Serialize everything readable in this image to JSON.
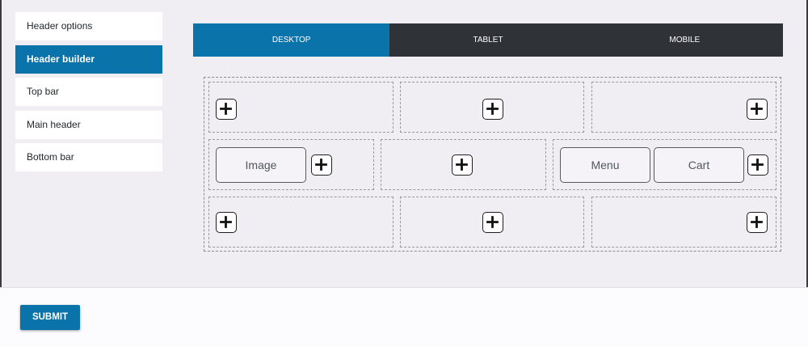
{
  "sidebar": {
    "items": [
      {
        "label": "Header options"
      },
      {
        "label": "Header builder"
      },
      {
        "label": "Top bar"
      },
      {
        "label": "Main header"
      },
      {
        "label": "Bottom bar"
      }
    ],
    "active_index": 1
  },
  "tabs": [
    {
      "label": "DESKTOP"
    },
    {
      "label": "TABLET"
    },
    {
      "label": "MOBILE"
    }
  ],
  "builder": {
    "rows": {
      "top": {
        "left": [],
        "center": [],
        "right": []
      },
      "main": {
        "left": [
          "Image"
        ],
        "center": [],
        "right": [
          "Menu",
          "Cart"
        ]
      },
      "bottom": {
        "left": [],
        "center": [],
        "right": []
      }
    },
    "add_icon": "plus-icon",
    "labels": {
      "image": "Image",
      "menu": "Menu",
      "cart": "Cart"
    }
  },
  "footer": {
    "submit_label": "SUBMIT"
  },
  "colors": {
    "accent": "#0a73aa",
    "tab_bar": "#2f3338",
    "background": "#f1eef3"
  }
}
